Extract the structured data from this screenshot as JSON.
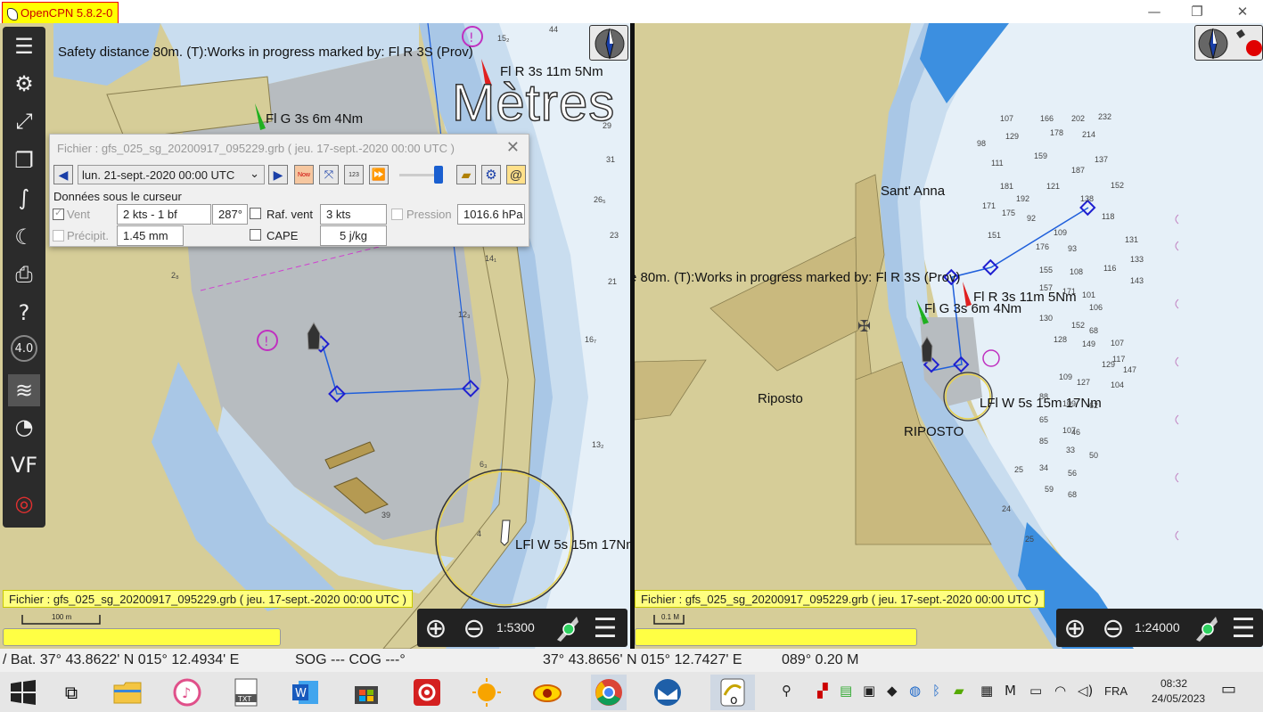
{
  "window": {
    "title": "OpenCPN 5.8.2-0",
    "controls": {
      "minimize": "—",
      "maximize": "❐",
      "close": "✕"
    }
  },
  "toolbar": {
    "items": [
      {
        "name": "menu-icon",
        "glyph": "☰"
      },
      {
        "name": "settings-gear-icon",
        "glyph": "⚙"
      },
      {
        "name": "route-icon",
        "glyph": "⤢"
      },
      {
        "name": "route-manager-icon",
        "glyph": "❐"
      },
      {
        "name": "track-icon",
        "glyph": "∫"
      },
      {
        "name": "tides-currents-icon",
        "glyph": "☾"
      },
      {
        "name": "print-icon",
        "glyph": "⎙"
      },
      {
        "name": "help-icon",
        "glyph": "?"
      },
      {
        "name": "grib-icon",
        "glyph": "4.0"
      },
      {
        "name": "chart-quilt-icon",
        "glyph": "≋"
      },
      {
        "name": "dashboard-gauge-icon",
        "glyph": "◔"
      },
      {
        "name": "vdr-icon",
        "glyph": "VF"
      },
      {
        "name": "lifebuoy-icon",
        "glyph": "◎"
      }
    ]
  },
  "left_chart": {
    "safety_text": "Safety distance 80m. (T):Works in progress marked by: Fl R 3S (Prov)",
    "units_overlay": "Mètres",
    "light_red": "Fl R 3s 11m 5Nm",
    "light_green": "Fl G 3s 6m 4Nm",
    "light_white": "LFl W 5s 15m 17Nm",
    "depths": [
      "44",
      "15₂",
      "29",
      "30",
      "31",
      "26₅",
      "23",
      "21",
      "14₁",
      "12₃",
      "16₇",
      "2₈",
      "13₂",
      "6₃",
      "39",
      "4"
    ],
    "grib_info": "Fichier : gfs_025_sg_20200917_095229.grb ( jeu. 17-sept.-2020 00:00  UTC )",
    "scale_label": "100 m",
    "zoom_scale": "1:5300"
  },
  "right_chart": {
    "safety_text": "e 80m. (T):Works in progress marked by: Fl R 3S (Prov)",
    "place_sant_anna": "Sant' Anna",
    "place_riposto": "Riposto",
    "place_riposto_caps": "RIPOSTO",
    "light_red": "Fl R 3s 11m 5Nm",
    "light_green": "Fl G 3s 6m 4Nm",
    "light_white": "LFl W 5s 15m 17Nm",
    "depths": [
      "107",
      "166",
      "202",
      "232",
      "129",
      "178",
      "214",
      "98",
      "111",
      "159",
      "187",
      "137",
      "181",
      "192",
      "121",
      "138",
      "152",
      "171",
      "175",
      "92",
      "109",
      "118",
      "131",
      "151",
      "176",
      "93",
      "133",
      "155",
      "108",
      "116",
      "143",
      "157",
      "171",
      "101",
      "106",
      "130",
      "152",
      "68",
      "107",
      "128",
      "149",
      "117",
      "129",
      "147",
      "109",
      "127",
      "104",
      "88",
      "109",
      "62",
      "65",
      "107",
      "46",
      "85",
      "33",
      "50",
      "34",
      "56",
      "25",
      "59",
      "68",
      "24",
      "25"
    ],
    "grib_info": "Fichier : gfs_025_sg_20200917_095229.grb ( jeu. 17-sept.-2020 00:00  UTC )",
    "scale_label": "0.1 M",
    "zoom_scale": "1:24000"
  },
  "grib_dialog": {
    "title": "Fichier : gfs_025_sg_20200917_095229.grb ( jeu. 17-sept.-2020 00:00  UTC )",
    "date_selected": "lun. 21-sept.-2020 00:00  UTC",
    "section_label": "Données sous le curseur",
    "wind_label": "Vent",
    "wind_speed": "2 kts -  1 bf",
    "wind_dir": "287°",
    "gust_label": "Raf. vent",
    "gust_value": "3 kts",
    "pressure_label": "Pression",
    "pressure_value": "1016.6 hPa",
    "precip_label": "Précipit.",
    "precip_value": "1.45 mm",
    "cape_label": "CAPE",
    "cape_value": "5 j/kg",
    "btn_now": "Now",
    "btn_123": "123"
  },
  "statusbar": {
    "boat_position": "/ Bat. 37° 43.8622' N   015° 12.4934' E",
    "sog_cog": "SOG --- COG ---°",
    "cursor_position": "37° 43.8656' N   015° 12.7427' E",
    "bearing_distance": "089°  0.20 M"
  },
  "taskbar": {
    "language": "FRA",
    "time": "08:32",
    "date": "24/05/2023"
  },
  "colors": {
    "land": "#d6cd98",
    "shallow": "#a9c7e6",
    "medium": "#c9ddef",
    "deep": "#e6f0f8",
    "harbor": "#b7bcc0",
    "yellow_banner": "#ffff80",
    "route": "#1f5fdb"
  }
}
